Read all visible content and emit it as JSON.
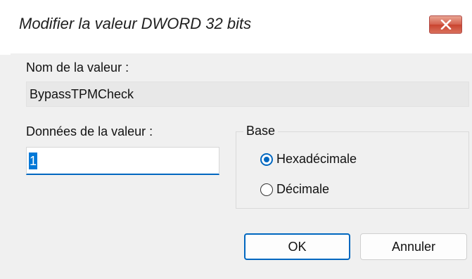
{
  "window": {
    "title": "Modifier la valeur DWORD 32 bits",
    "close_icon": "close-x-icon",
    "close_color": "#c9442f"
  },
  "value_name": {
    "label": "Nom de la valeur :",
    "value": "BypassTPMCheck"
  },
  "value_data": {
    "label": "Données de la valeur :",
    "value": "1"
  },
  "base": {
    "legend": "Base",
    "options": [
      {
        "label": "Hexadécimale",
        "selected": true
      },
      {
        "label": "Décimale",
        "selected": false
      }
    ]
  },
  "buttons": {
    "ok": "OK",
    "cancel": "Annuler"
  },
  "colors": {
    "accent": "#0067c0",
    "selection": "#0078d7"
  }
}
